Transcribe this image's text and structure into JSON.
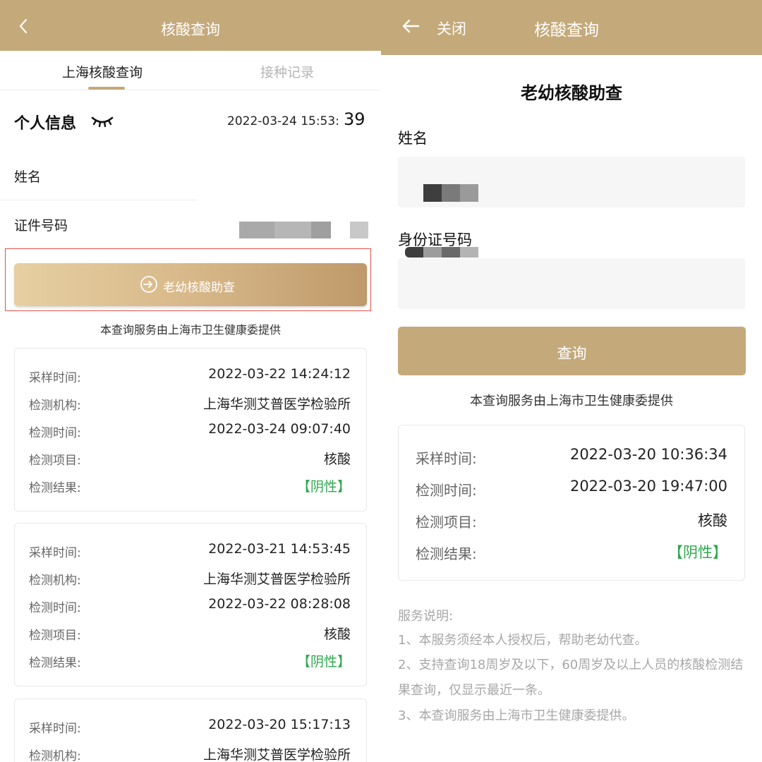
{
  "left": {
    "header": {
      "title": "核酸查询"
    },
    "tabs": [
      {
        "label": "上海核酸查询",
        "active": true
      },
      {
        "label": "接种记录",
        "active": false
      }
    ],
    "personal_info": {
      "title": "个人信息",
      "timestamp_main": "2022-03-24 15:53:",
      "timestamp_seconds": "39",
      "name_label": "姓名",
      "id_label": "证件号码"
    },
    "elder_child_button": "老幼核酸助查",
    "provided_by": "本查询服务由上海市卫生健康委提供",
    "labels": {
      "sample_time": "采样时间:",
      "institution": "检测机构:",
      "test_time": "检测时间:",
      "item": "检测项目:",
      "result": "检测结果:"
    },
    "records": [
      {
        "sample_time": "2022-03-22 14:24:12",
        "institution": "上海华测艾普医学检验所",
        "test_time": "2022-03-24 09:07:40",
        "item": "核酸",
        "result": "【阴性】"
      },
      {
        "sample_time": "2022-03-21 14:53:45",
        "institution": "上海华测艾普医学检验所",
        "test_time": "2022-03-22 08:28:08",
        "item": "核酸",
        "result": "【阴性】"
      },
      {
        "sample_time": "2022-03-20 15:17:13",
        "institution": "上海华测艾普医学检验所"
      }
    ]
  },
  "right": {
    "header": {
      "back_icon": "arrow-left-icon",
      "close_label": "关闭",
      "title": "核酸查询"
    },
    "form_title": "老幼核酸助查",
    "name_label": "姓名",
    "id_label": "身份证号码",
    "query_button": "查询",
    "provided_by": "本查询服务由上海市卫生健康委提供",
    "labels": {
      "sample_time": "采样时间:",
      "test_time": "检测时间:",
      "item": "检测项目:",
      "result": "检测结果:"
    },
    "result": {
      "sample_time": "2022-03-20 10:36:34",
      "test_time": "2022-03-20 19:47:00",
      "item": "核酸",
      "result": "【阴性】"
    },
    "notes": {
      "title": "服务说明:",
      "items": [
        "1、本服务须经本人授权后，帮助老幼代查。",
        "2、支持查询18周岁及以下，60周岁及以上人员的核酸检测结果查询，仅显示最近一条。",
        "3、本查询服务由上海市卫生健康委提供。"
      ]
    }
  },
  "colors": {
    "brand": "#c4a97a",
    "negative_green": "#2ea84e",
    "highlight_red": "#e0514a"
  }
}
